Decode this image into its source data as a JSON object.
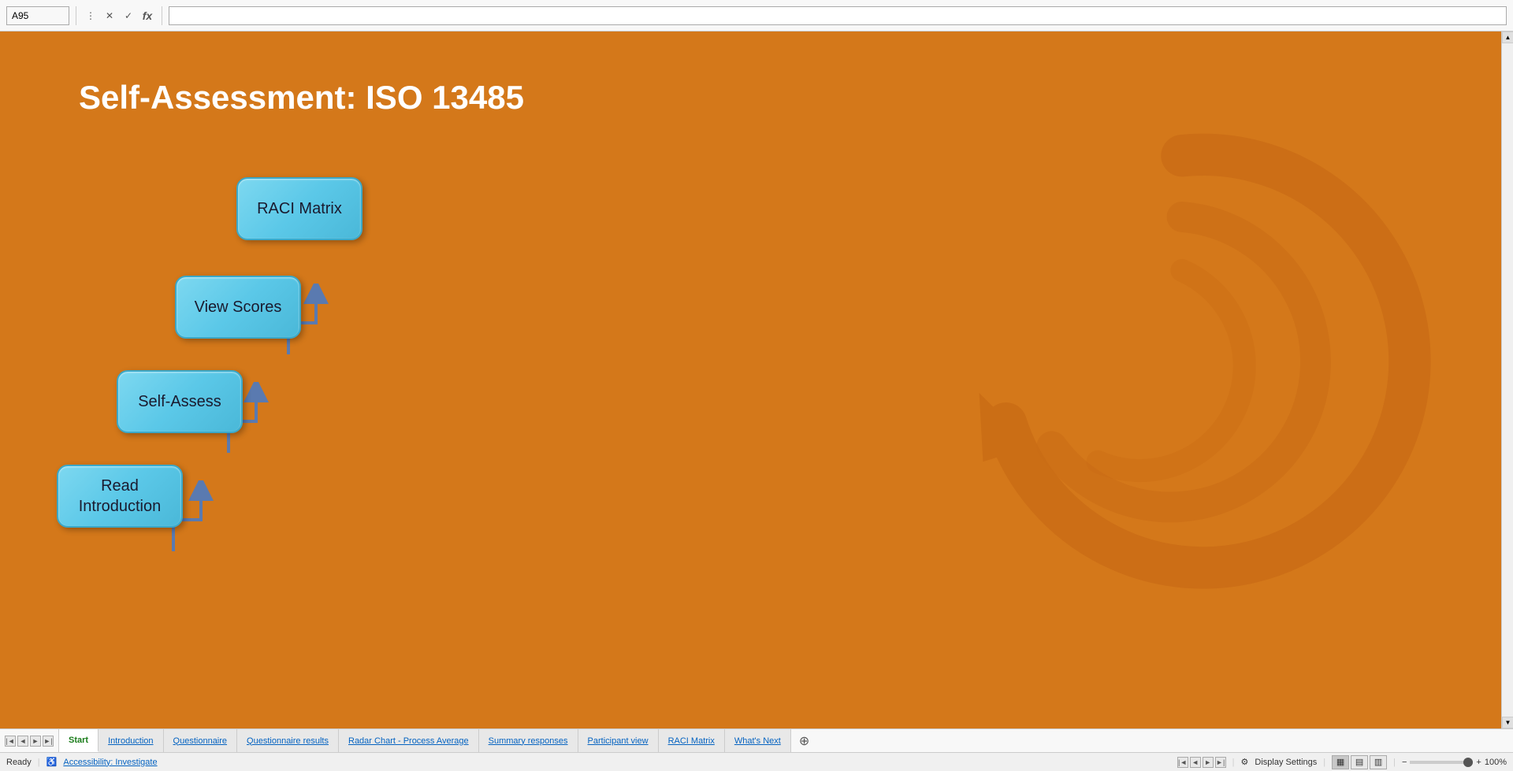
{
  "excel_toolbar": {
    "cell_ref": "A95",
    "formula_content": ""
  },
  "page": {
    "title": "Self-Assessment: ISO 13485",
    "background_color": "#d4781a"
  },
  "buttons": [
    {
      "id": "raci",
      "label": "RACI Matrix"
    },
    {
      "id": "scores",
      "label": "View Scores"
    },
    {
      "id": "selfassess",
      "label": "Self-Assess"
    },
    {
      "id": "intro",
      "label": "Read\nIntroduction"
    }
  ],
  "sheet_tabs": [
    {
      "id": "start",
      "label": "Start",
      "active": true
    },
    {
      "id": "introduction",
      "label": "Introduction",
      "active": false
    },
    {
      "id": "questionnaire",
      "label": "Questionnaire",
      "active": false
    },
    {
      "id": "questionnaire-results",
      "label": "Questionnaire results",
      "active": false
    },
    {
      "id": "radar-chart",
      "label": "Radar Chart - Process Average",
      "active": false
    },
    {
      "id": "summary-responses",
      "label": "Summary responses",
      "active": false
    },
    {
      "id": "participant-view",
      "label": "Participant view",
      "active": false
    },
    {
      "id": "raci-matrix",
      "label": "RACI Matrix",
      "active": false
    },
    {
      "id": "whats-next",
      "label": "What's Next",
      "active": false
    }
  ],
  "status_bar": {
    "ready_label": "Ready",
    "accessibility_label": "Accessibility: Investigate",
    "display_settings_label": "Display Settings",
    "zoom_level": "100%"
  },
  "icons": {
    "close": "✕",
    "check": "✓",
    "formula": "fx",
    "more_options": "⋮",
    "add_sheet": "⊕",
    "scroll_up": "▲",
    "scroll_down": "▼",
    "scroll_left": "◄",
    "scroll_right_icon": "►",
    "accessibility": "♿",
    "display_settings": "⚙"
  }
}
